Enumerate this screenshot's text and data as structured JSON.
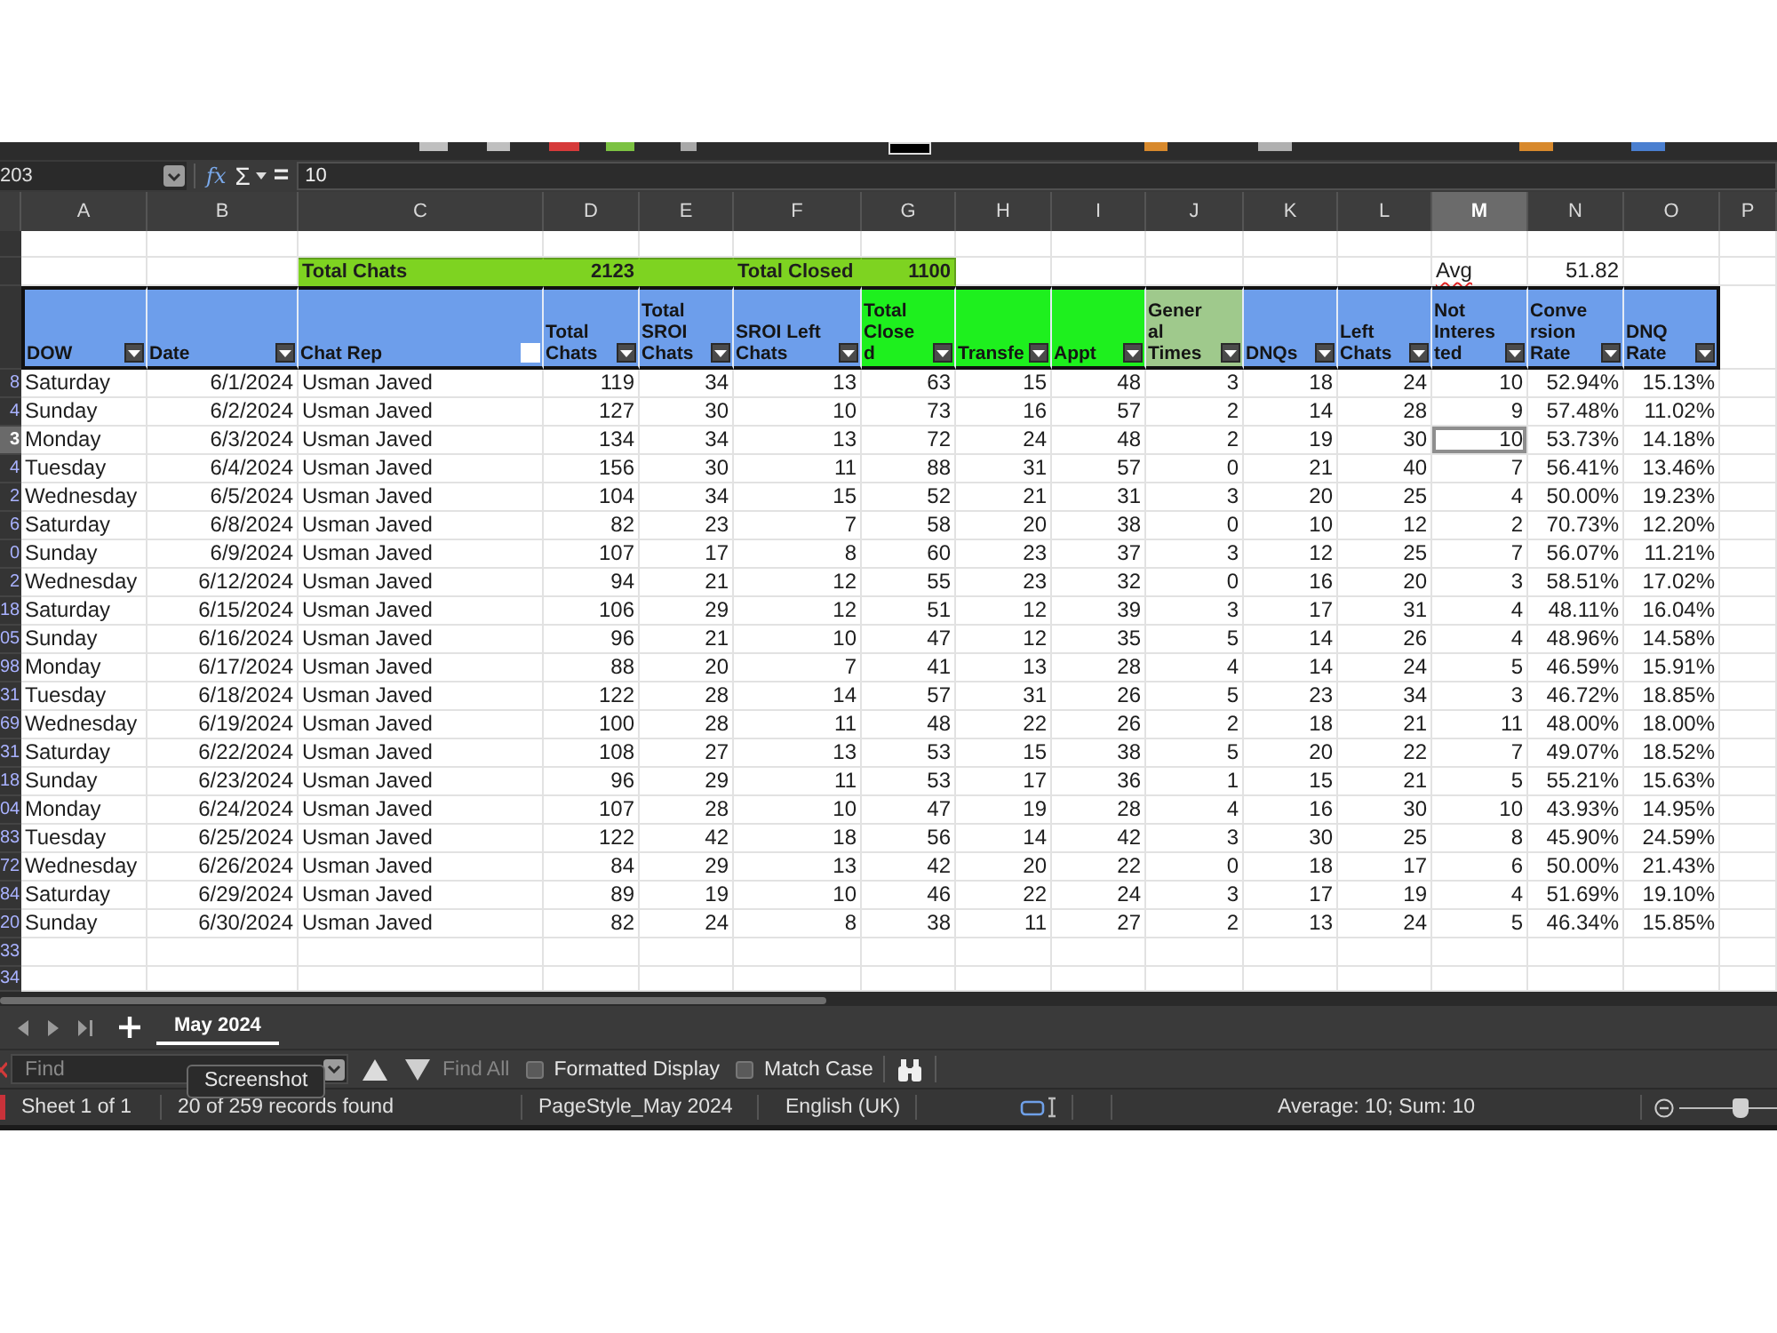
{
  "formula_bar": {
    "name_box": "203",
    "function_wizard": "fx",
    "sum": "Σ",
    "equals": "=",
    "content": "10"
  },
  "columns": [
    {
      "letter": "A",
      "selected": false
    },
    {
      "letter": "B",
      "selected": false
    },
    {
      "letter": "C",
      "selected": false
    },
    {
      "letter": "D",
      "selected": false
    },
    {
      "letter": "E",
      "selected": false
    },
    {
      "letter": "F",
      "selected": false
    },
    {
      "letter": "G",
      "selected": false
    },
    {
      "letter": "H",
      "selected": false
    },
    {
      "letter": "I",
      "selected": false
    },
    {
      "letter": "J",
      "selected": false
    },
    {
      "letter": "K",
      "selected": false
    },
    {
      "letter": "L",
      "selected": false
    },
    {
      "letter": "M",
      "selected": true
    },
    {
      "letter": "N",
      "selected": false
    },
    {
      "letter": "O",
      "selected": false
    },
    {
      "letter": "P",
      "selected": false
    }
  ],
  "summary": {
    "total_chats_label": "Total Chats",
    "total_chats": "2123",
    "total_closed_label": "Total Closed",
    "total_closed": "1100",
    "avg_label": "Avg",
    "avg_label_misspelled": true,
    "avg": "51.82"
  },
  "headers": [
    {
      "label": "DOW",
      "color": "#6d9eeb",
      "kind": "arrow"
    },
    {
      "label": "Date",
      "color": "#6d9eeb",
      "kind": "arrow"
    },
    {
      "label": "Chat Rep",
      "color": "#6d9eeb",
      "kind": "blank"
    },
    {
      "label": "Total\nChats",
      "color": "#6d9eeb",
      "kind": "arrow"
    },
    {
      "label": "Total\nSROI\nChats",
      "color": "#6d9eeb",
      "kind": "arrow"
    },
    {
      "label": "SROI Left\nChats",
      "color": "#6d9eeb",
      "kind": "arrow"
    },
    {
      "label": "Total\nClose\nd",
      "color": "#1ef01e",
      "kind": "arrow"
    },
    {
      "label": "Transfe",
      "color": "#1ef01e",
      "kind": "arrow"
    },
    {
      "label": "Appt",
      "color": "#1ef01e",
      "kind": "arrow"
    },
    {
      "label": "Gener\nal\nTimes",
      "color": "#9fc98c",
      "kind": "arrow"
    },
    {
      "label": "DNQs",
      "color": "#6d9eeb",
      "kind": "arrow"
    },
    {
      "label": "Left\nChats",
      "color": "#6d9eeb",
      "kind": "arrow"
    },
    {
      "label": "Not\nInteres\nted",
      "color": "#6d9eeb",
      "kind": "arrow"
    },
    {
      "label": "Conve\nrsion\nRate",
      "color": "#6d9eeb",
      "kind": "arrow"
    },
    {
      "label": "DNQ\nRate",
      "color": "#6d9eeb",
      "kind": "arrow"
    }
  ],
  "rows": [
    {
      "row_number": "8",
      "selected": false,
      "cells": [
        "Saturday",
        "6/1/2024",
        "Usman Javed",
        "119",
        "34",
        "13",
        "63",
        "15",
        "48",
        "3",
        "18",
        "24",
        "10",
        "52.94%",
        "15.13%"
      ]
    },
    {
      "row_number": "4",
      "selected": false,
      "cells": [
        "Sunday",
        "6/2/2024",
        "Usman Javed",
        "127",
        "30",
        "10",
        "73",
        "16",
        "57",
        "2",
        "14",
        "28",
        "9",
        "57.48%",
        "11.02%"
      ]
    },
    {
      "row_number": "3",
      "selected": true,
      "cells": [
        "Monday",
        "6/3/2024",
        "Usman Javed",
        "134",
        "34",
        "13",
        "72",
        "24",
        "48",
        "2",
        "19",
        "30",
        "10",
        "53.73%",
        "14.18%"
      ]
    },
    {
      "row_number": "4",
      "selected": false,
      "cells": [
        "Tuesday",
        "6/4/2024",
        "Usman Javed",
        "156",
        "30",
        "11",
        "88",
        "31",
        "57",
        "0",
        "21",
        "40",
        "7",
        "56.41%",
        "13.46%"
      ]
    },
    {
      "row_number": "2",
      "selected": false,
      "cells": [
        "Wednesday",
        "6/5/2024",
        "Usman Javed",
        "104",
        "34",
        "15",
        "52",
        "21",
        "31",
        "3",
        "20",
        "25",
        "4",
        "50.00%",
        "19.23%"
      ]
    },
    {
      "row_number": "6",
      "selected": false,
      "cells": [
        "Saturday",
        "6/8/2024",
        "Usman Javed",
        "82",
        "23",
        "7",
        "58",
        "20",
        "38",
        "0",
        "10",
        "12",
        "2",
        "70.73%",
        "12.20%"
      ]
    },
    {
      "row_number": "0",
      "selected": false,
      "cells": [
        "Sunday",
        "6/9/2024",
        "Usman Javed",
        "107",
        "17",
        "8",
        "60",
        "23",
        "37",
        "3",
        "12",
        "25",
        "7",
        "56.07%",
        "11.21%"
      ]
    },
    {
      "row_number": "2",
      "selected": false,
      "cells": [
        "Wednesday",
        "6/12/2024",
        "Usman Javed",
        "94",
        "21",
        "12",
        "55",
        "23",
        "32",
        "0",
        "16",
        "20",
        "3",
        "58.51%",
        "17.02%"
      ]
    },
    {
      "row_number": "18",
      "selected": false,
      "cells": [
        "Saturday",
        "6/15/2024",
        "Usman Javed",
        "106",
        "29",
        "12",
        "51",
        "12",
        "39",
        "3",
        "17",
        "31",
        "4",
        "48.11%",
        "16.04%"
      ]
    },
    {
      "row_number": "05",
      "selected": false,
      "cells": [
        "Sunday",
        "6/16/2024",
        "Usman Javed",
        "96",
        "21",
        "10",
        "47",
        "12",
        "35",
        "5",
        "14",
        "26",
        "4",
        "48.96%",
        "14.58%"
      ]
    },
    {
      "row_number": "98",
      "selected": false,
      "cells": [
        "Monday",
        "6/17/2024",
        "Usman Javed",
        "88",
        "20",
        "7",
        "41",
        "13",
        "28",
        "4",
        "14",
        "24",
        "5",
        "46.59%",
        "15.91%"
      ]
    },
    {
      "row_number": "31",
      "selected": false,
      "cells": [
        "Tuesday",
        "6/18/2024",
        "Usman Javed",
        "122",
        "28",
        "14",
        "57",
        "31",
        "26",
        "5",
        "23",
        "34",
        "3",
        "46.72%",
        "18.85%"
      ]
    },
    {
      "row_number": "69",
      "selected": false,
      "cells": [
        "Wednesday",
        "6/19/2024",
        "Usman Javed",
        "100",
        "28",
        "11",
        "48",
        "22",
        "26",
        "2",
        "18",
        "21",
        "11",
        "48.00%",
        "18.00%"
      ]
    },
    {
      "row_number": "31",
      "selected": false,
      "cells": [
        "Saturday",
        "6/22/2024",
        "Usman Javed",
        "108",
        "27",
        "13",
        "53",
        "15",
        "38",
        "5",
        "20",
        "22",
        "7",
        "49.07%",
        "18.52%"
      ]
    },
    {
      "row_number": "18",
      "selected": false,
      "cells": [
        "Sunday",
        "6/23/2024",
        "Usman Javed",
        "96",
        "29",
        "11",
        "53",
        "17",
        "36",
        "1",
        "15",
        "21",
        "5",
        "55.21%",
        "15.63%"
      ]
    },
    {
      "row_number": "04",
      "selected": false,
      "cells": [
        "Monday",
        "6/24/2024",
        "Usman Javed",
        "107",
        "28",
        "10",
        "47",
        "19",
        "28",
        "4",
        "16",
        "30",
        "10",
        "43.93%",
        "14.95%"
      ]
    },
    {
      "row_number": "83",
      "selected": false,
      "cells": [
        "Tuesday",
        "6/25/2024",
        "Usman Javed",
        "122",
        "42",
        "18",
        "56",
        "14",
        "42",
        "3",
        "30",
        "25",
        "8",
        "45.90%",
        "24.59%"
      ]
    },
    {
      "row_number": "72",
      "selected": false,
      "cells": [
        "Wednesday",
        "6/26/2024",
        "Usman Javed",
        "84",
        "29",
        "13",
        "42",
        "20",
        "22",
        "0",
        "18",
        "17",
        "6",
        "50.00%",
        "21.43%"
      ]
    },
    {
      "row_number": "84",
      "selected": false,
      "cells": [
        "Saturday",
        "6/29/2024",
        "Usman Javed",
        "89",
        "19",
        "10",
        "46",
        "22",
        "24",
        "3",
        "17",
        "19",
        "4",
        "51.69%",
        "19.10%"
      ]
    },
    {
      "row_number": "20",
      "selected": false,
      "cells": [
        "Sunday",
        "6/30/2024",
        "Usman Javed",
        "82",
        "24",
        "8",
        "38",
        "11",
        "27",
        "2",
        "13",
        "24",
        "5",
        "46.34%",
        "15.85%"
      ]
    }
  ],
  "empty_rows": [
    "33",
    "34"
  ],
  "sheet_tabs": [
    {
      "label": "May 2024",
      "selected": true
    }
  ],
  "find_bar": {
    "placeholder": "Find",
    "find_all": "Find All",
    "find_all_disabled": true,
    "options": [
      {
        "label": "Formatted Display",
        "checked": false
      },
      {
        "label": "Match Case",
        "checked": false
      }
    ]
  },
  "tooltip": "Screenshot",
  "status_bar": {
    "sheet": "Sheet 1 of 1",
    "records": "20 of 259 records found",
    "page_style": "PageStyle_May 2024",
    "language": "English (UK)",
    "selection_summary": "Average: 10; Sum: 10",
    "zoom": {
      "level": 0.62
    }
  }
}
